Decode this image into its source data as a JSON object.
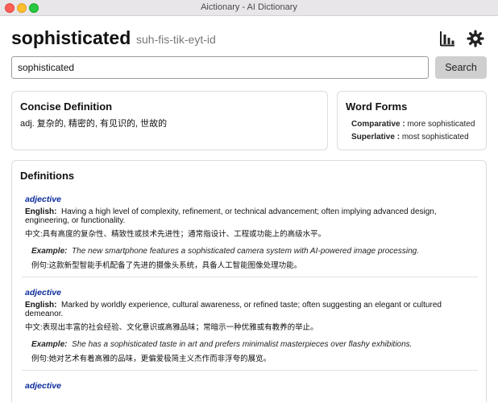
{
  "window": {
    "title": "Aictionary - AI Dictionary"
  },
  "header": {
    "word": "sophisticated",
    "pronunciation": "suh-fis-tik-eyt-id"
  },
  "search": {
    "value": "sophisticated",
    "button_label": "Search"
  },
  "concise": {
    "title": "Concise Definition",
    "text": "adj. 复杂的, 精密的, 有见识的, 世故的"
  },
  "word_forms": {
    "title": "Word Forms",
    "items": [
      {
        "label": "Comparative :",
        "value": "more sophisticated"
      },
      {
        "label": "Superlative :",
        "value": "most sophisticated"
      }
    ]
  },
  "definitions": {
    "title": "Definitions",
    "english_label": "English:",
    "chinese_label": "中文:",
    "example_label": "Example:",
    "example_zh_label": "例句:",
    "items": [
      {
        "pos": "adjective",
        "english": "Having a high level of complexity, refinement, or technical advancement; often implying advanced design, engineering, or functionality.",
        "chinese": "具有高度的复杂性、精致性或技术先进性；通常指设计、工程或功能上的高级水平。",
        "example_en": "The new smartphone features a sophisticated camera system with AI-powered image processing.",
        "example_zh": "这款新型智能手机配备了先进的摄像头系统，具备人工智能图像处理功能。"
      },
      {
        "pos": "adjective",
        "english": "Marked by worldly experience, cultural awareness, or refined taste; often suggesting an elegant or cultured demeanor.",
        "chinese": "表现出丰富的社会经验、文化意识或高雅品味；常暗示一种优雅或有教养的举止。",
        "example_en": "She has a sophisticated taste in art and prefers minimalist masterpieces over flashy exhibitions.",
        "example_zh": "她对艺术有着高雅的品味，更偏爱极简主义杰作而非浮夸的展览。"
      },
      {
        "pos": "adjective"
      }
    ]
  },
  "icons": {
    "stats": "bar-chart-icon",
    "settings": "gear-icon"
  }
}
